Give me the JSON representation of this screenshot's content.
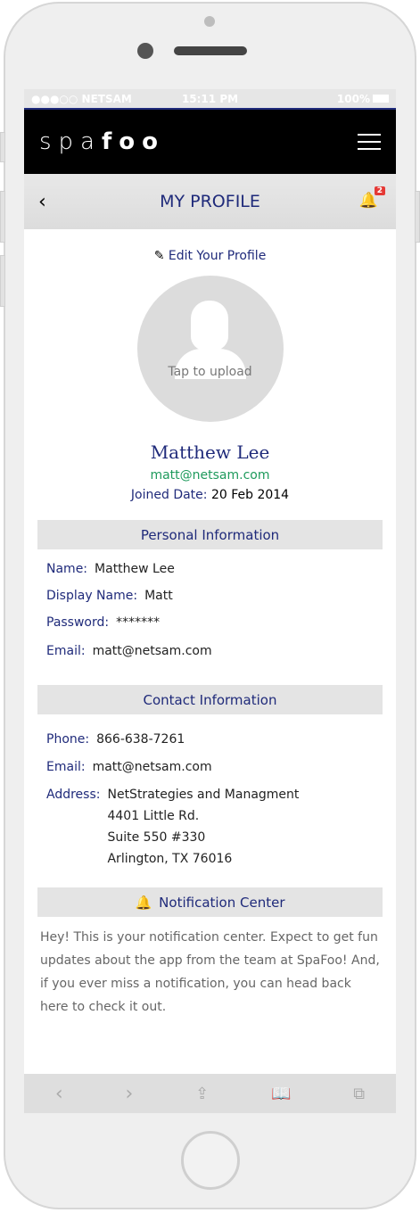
{
  "status_bar": {
    "carrier": "●●●○○ NETSAM",
    "time": "15:11 PM",
    "battery": "100%"
  },
  "app": {
    "logo_light": "spa",
    "logo_bold": "foo"
  },
  "header": {
    "title": "MY PROFILE",
    "notification_count": "2"
  },
  "profile": {
    "edit_label": "Edit Your Profile",
    "upload_label": "Tap to upload",
    "name": "Matthew Lee",
    "email": "matt@netsam.com",
    "joined_label": "Joined Date:",
    "joined_value": "20 Feb 2014"
  },
  "personal": {
    "heading": "Personal Information",
    "rows": [
      {
        "label": "Name:",
        "value": "Matthew Lee"
      },
      {
        "label": "Display Name:",
        "value": "Matt"
      },
      {
        "label": "Password:",
        "value": "*******"
      },
      {
        "label": "Email:",
        "value": "matt@netsam.com"
      }
    ]
  },
  "contact": {
    "heading": "Contact Information",
    "phone_label": "Phone:",
    "phone": "866-638-7261",
    "email_label": "Email:",
    "email": "matt@netsam.com",
    "address_label": "Address:",
    "address": [
      "NetStrategies and Managment",
      "4401 Little Rd.",
      "Suite 550 #330",
      "Arlington, TX 76016"
    ]
  },
  "notifications": {
    "heading": "Notification Center",
    "body": "Hey! This is your notification center. Expect to get fun updates about the app from the team at SpaFoo! And, if you ever miss a notification, you can head back here to check it out."
  },
  "colors": {
    "accent": "#1f2a7a",
    "email": "#1e9a5c",
    "badge": "#e53935"
  }
}
